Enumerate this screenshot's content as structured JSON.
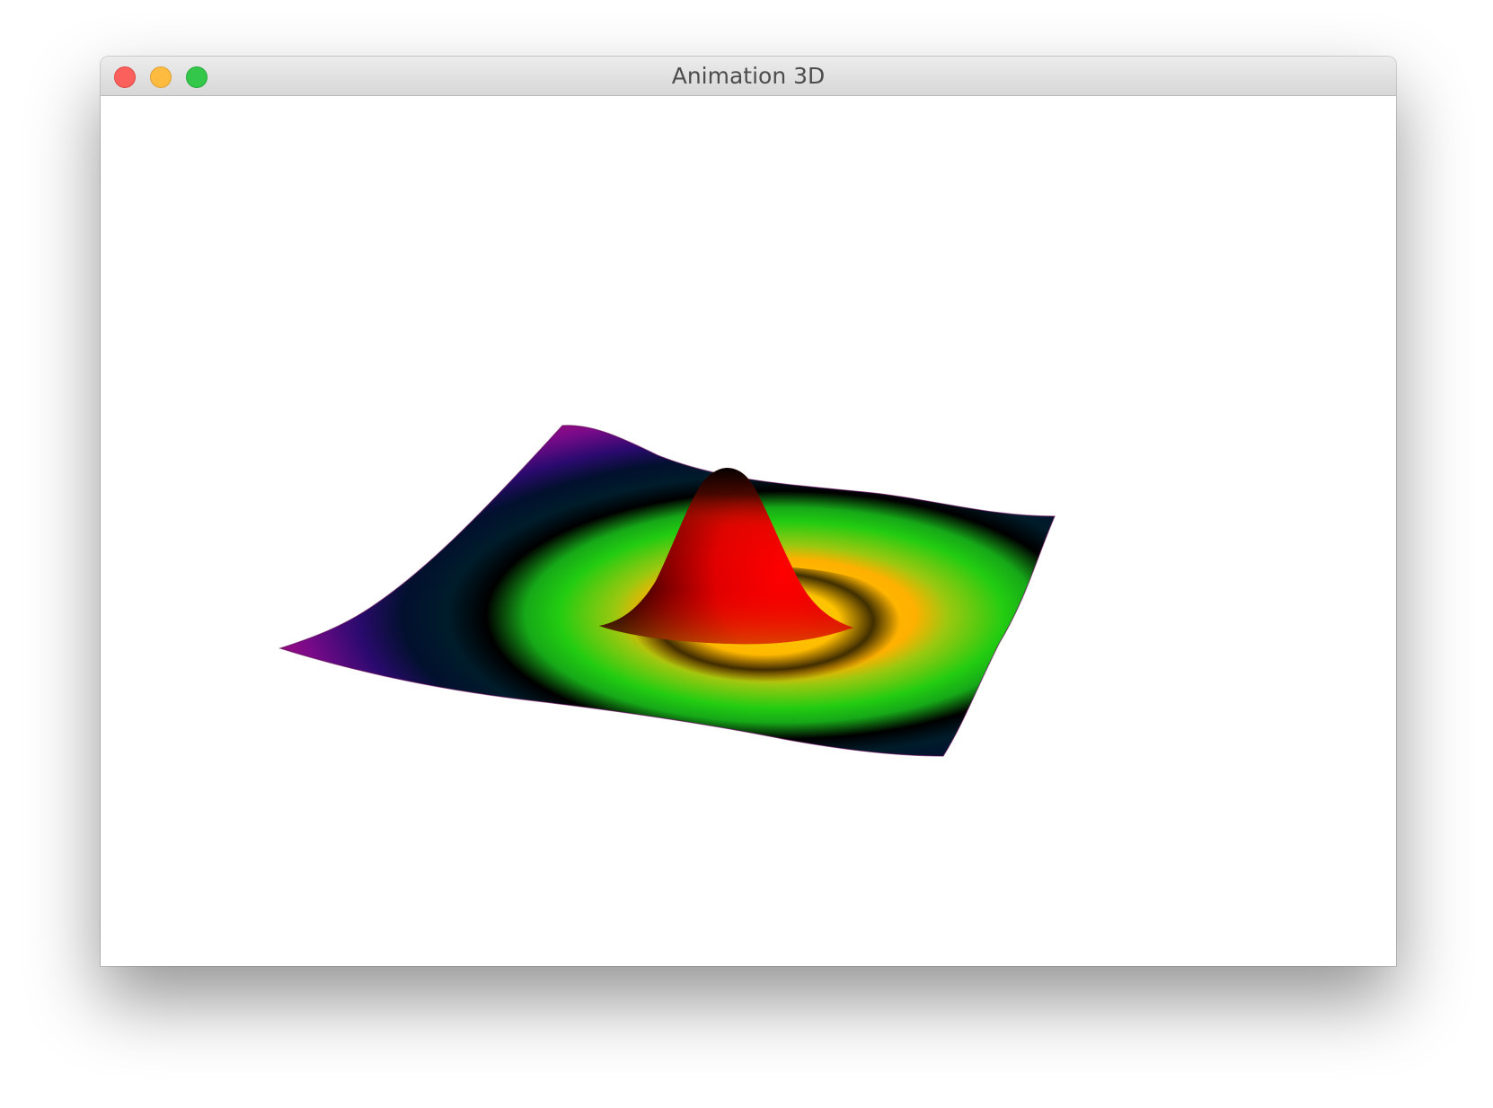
{
  "window": {
    "title": "Animation 3D",
    "buttons": {
      "close": "close",
      "minimize": "minimize",
      "zoom": "zoom"
    }
  },
  "scene": {
    "type": "3d-surface",
    "colors": {
      "peak": "#ff0000",
      "peak_top": "#000000",
      "inner_ring": "#ffd000",
      "ring": "#22cc11",
      "trough": "#000000",
      "trough_edge": "#001a33",
      "outer": "#2a0a6e",
      "edge": "#b01090",
      "corner": "#c0106a"
    }
  }
}
